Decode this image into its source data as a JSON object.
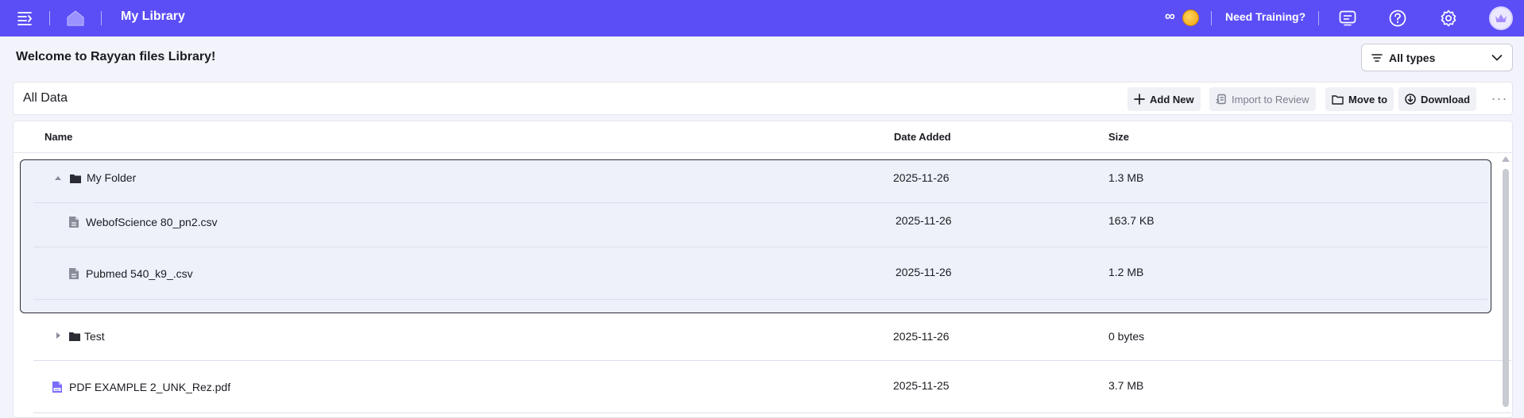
{
  "topbar": {
    "title": "My Library",
    "infinity": "∞",
    "training_label": "Need Training?",
    "icons": [
      "menu-collapse-icon",
      "home-icon",
      "chat-icon",
      "help-icon",
      "gear-icon",
      "avatar-crown-icon"
    ],
    "accent": "#5b4ef6"
  },
  "welcome": {
    "text": "Welcome to Rayyan files Library!",
    "filter_label": "All types"
  },
  "toolbar": {
    "title": "All Data",
    "add_new": "Add New",
    "import_to_review": "Import to Review",
    "move_to": "Move to",
    "download": "Download",
    "more": "···"
  },
  "table": {
    "columns": [
      "Name",
      "Date Added",
      "Size"
    ],
    "rows": [
      {
        "name": "My Folder",
        "type": "folder",
        "expanded": true,
        "date": "2025-11-26",
        "size": "1.3 MB"
      },
      {
        "name": "WebofScience 80_pn2.csv",
        "type": "csv",
        "date": "2025-11-26",
        "size": "163.7 KB"
      },
      {
        "name": "Pubmed 540_k9_.csv",
        "type": "csv",
        "date": "2025-11-26",
        "size": "1.2 MB"
      },
      {
        "name": "Test",
        "type": "folder",
        "expanded": false,
        "date": "2025-11-26",
        "size": "0 bytes"
      },
      {
        "name": "PDF EXAMPLE 2_UNK_Rez.pdf",
        "type": "pdf",
        "date": "2025-11-25",
        "size": "3.7 MB"
      }
    ]
  }
}
